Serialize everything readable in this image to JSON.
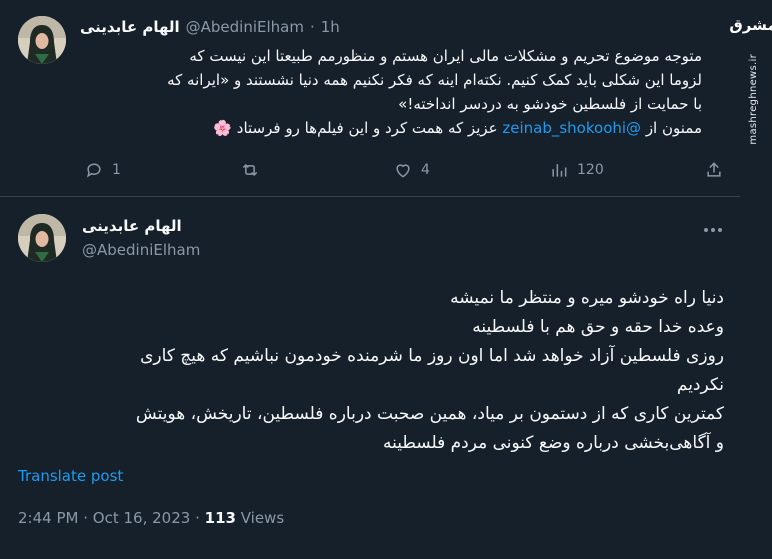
{
  "watermark": {
    "logo": "مشرق",
    "site": "mashreghnews.ir"
  },
  "tweet1": {
    "author_name": "الهام عابدینی",
    "handle": "@AbediniElham",
    "separator": "·",
    "time": "1h",
    "lines": [
      "متوجه موضوع تحریم و مشکلات مالی ایران هستم و منظورمم طبیعتا این نیست که",
      "لزوما این شکلی باید کمک کنیم. نکته‌ام اینه که فکر نکنیم همه دنیا نشستند و «ایرانه که",
      "با حمایت از فلسطین خودشو به دردسر انداخته!»"
    ],
    "line4_before": "ممنون از ",
    "mention": "@zeinab_shokoohi",
    "line4_after": " عزیز که همت کرد و این فیلم‌ها رو فرستاد",
    "emoji": "🌸",
    "replies": "1",
    "likes": "4",
    "views": "120"
  },
  "tweet2": {
    "author_name": "الهام عابدینی",
    "handle": "@AbediniElham",
    "lines": [
      "دنیا راه خودشو میره و منتظر ما نمیشه",
      "وعده خدا حقه و حق هم با فلسطینه",
      "روزی فلسطین آزاد خواهد شد اما اون روز ما شرمنده خودمون نباشیم که هیچ کاری",
      "نکردیم",
      "کمترین کاری که از دستمون بر میاد، همین صحبت درباره فلسطین، تاریخش، هویتش",
      "و آگاهی‌بخشی درباره وضع کنونی مردم فلسطینه"
    ],
    "translate_label": "Translate post",
    "time": "2:44 PM",
    "dot": "·",
    "date": "Oct 16, 2023",
    "views_count": "113",
    "views_label": "Views"
  }
}
